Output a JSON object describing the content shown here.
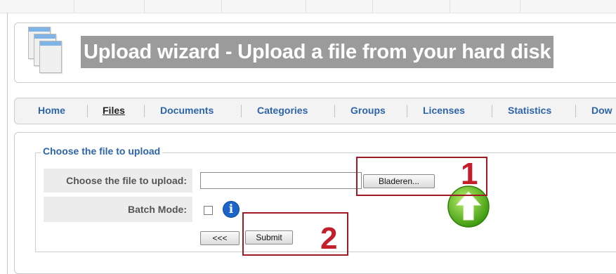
{
  "header": {
    "title": "Upload wizard - Upload a file from your hard disk"
  },
  "nav": {
    "items": [
      {
        "label": "Home",
        "active": false
      },
      {
        "label": "Files",
        "active": true
      },
      {
        "label": "Documents",
        "active": false
      },
      {
        "label": "Categories",
        "active": false
      },
      {
        "label": "Groups",
        "active": false
      },
      {
        "label": "Licenses",
        "active": false
      },
      {
        "label": "Statistics",
        "active": false
      },
      {
        "label": "Dow",
        "active": false
      }
    ]
  },
  "form": {
    "legend": "Choose the file to upload",
    "file_label": "Choose the file to upload:",
    "file_value": "",
    "browse_label": "Bladeren...",
    "batch_label": "Batch Mode:",
    "batch_checked": false,
    "info_glyph": "i",
    "back_label": "<<<",
    "submit_label": "Submit"
  },
  "annotations": {
    "step1": "1",
    "step2": "2"
  },
  "icons": {
    "header_icon": "document-stack-icon",
    "info_icon": "info-icon",
    "upload_icon": "green-up-arrow-icon"
  },
  "colors": {
    "link": "#2e64a8",
    "callout": "#c21f2b",
    "title_bg": "#9b9b9b"
  }
}
